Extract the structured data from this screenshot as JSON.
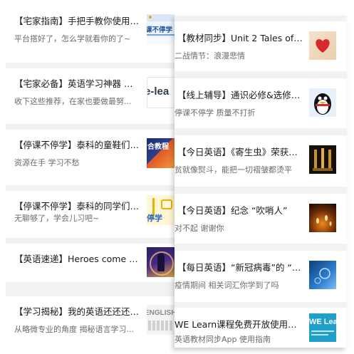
{
  "left": [
    {
      "title": "【宅家指南】手把手教你使用 #...",
      "subtitle": "平台搭好了，怎么学就看你的了~",
      "thumb_text": "课不停学",
      "thumb_icon": "poster-thumbnail"
    },
    {
      "title": "【宅家必备】英语学习神器 良...",
      "subtitle": "收下这些推荐，在家也要做最努...",
      "thumb_text": "e-lea",
      "thumb_icon": "elearning-thumbnail"
    },
    {
      "title": "【停课不停学】泰科的童鞋们，...",
      "subtitle": "资源在手 学习不愁",
      "thumb_text": "合教程",
      "thumb_icon": "tutorial-thumbnail"
    },
    {
      "title": "【停课不停学】泰科的同学们，...",
      "subtitle": "无聊够了，学会儿习吧~",
      "thumb_text": "停学",
      "thumb_icon": "study-thumbnail"
    },
    {
      "title": "【英语速递】Heroes come and...",
      "subtitle": "",
      "thumb_text": "",
      "thumb_icon": "hero-thumbnail"
    },
    {
      "title": "【学习揭秘】我的英语还还还有...",
      "subtitle": "从略微专业的角度 揭秘语言学习...",
      "thumb_text": "ENGLISH",
      "thumb_icon": "english-thumbnail"
    }
  ],
  "right": [
    {
      "title": "【教材同步】Unit 2 Tales of Tr...",
      "subtitle": "二战情节：浪漫悲情",
      "thumb_text": "",
      "thumb_icon": "heart-thumbnail"
    },
    {
      "title": "【线上辅导】通识必修&选修课...",
      "subtitle": "停课不停学 质量不打折",
      "thumb_text": "",
      "thumb_icon": "penguin-thumbnail"
    },
    {
      "title": "【今日英语】《寄生虫》荣获奥...",
      "subtitle": "贫就像熨斗，能把一切褶皱都烫平",
      "thumb_text": "",
      "thumb_icon": "oscar-thumbnail"
    },
    {
      "title": "【今日英语】纪念 “吹哨人”",
      "subtitle": "对不起 谢谢你",
      "thumb_text": "",
      "thumb_icon": "candles-thumbnail"
    },
    {
      "title": "【每日英语】“新冠病毒”的 “新...",
      "subtitle": "疫情期间 相关词汇你学到了吗",
      "thumb_text": "",
      "thumb_icon": "virus-thumbnail"
    },
    {
      "title": "WE Learn课程免费开放使用指南",
      "subtitle": "英语教材同步App 使用指南",
      "thumb_text": "WE Learn",
      "thumb_icon": "welearn-thumbnail"
    }
  ]
}
